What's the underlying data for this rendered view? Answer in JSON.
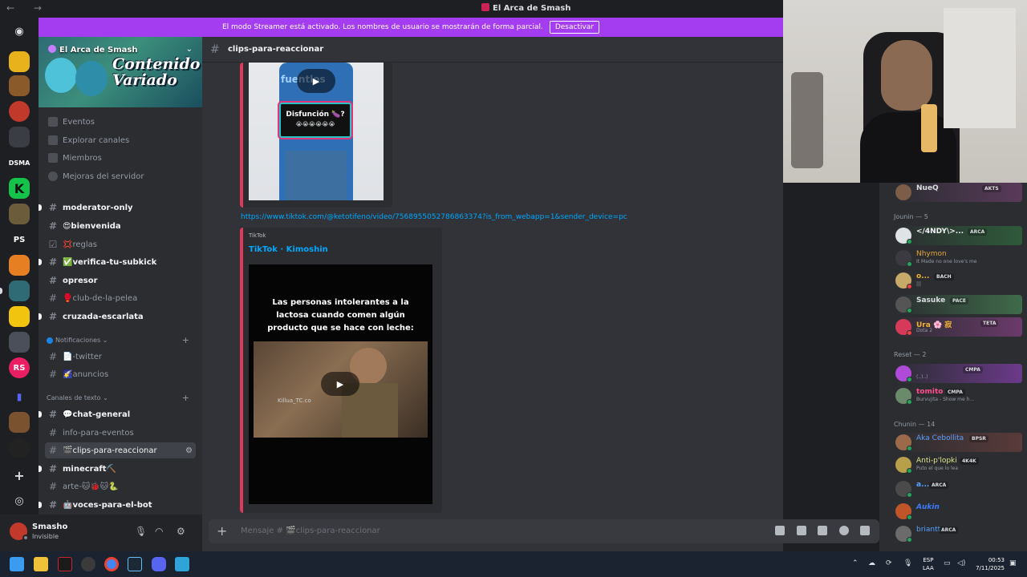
{
  "window": {
    "title": "El Arca de Smash",
    "nav": "← →"
  },
  "streamer_banner": {
    "text": "El modo Streamer está activado. Los nombres de usuario se mostrarán de forma parcial.",
    "button": "Desactivar"
  },
  "server": {
    "name": "El Arca de Smash",
    "banner_text_1": "Contenido",
    "banner_text_2": "Variado"
  },
  "rail": {
    "ps_label": "PS",
    "dsm_label": "DSMA"
  },
  "sidebar_meta": {
    "events": "Eventos",
    "explore": "Explorar canales",
    "members": "Miembros",
    "boost": "Mejoras del servidor"
  },
  "channels": {
    "c1": "moderator-only",
    "c2": "😍bienvenida",
    "c3": "💢reglas",
    "c4": "✅verifica-tu-subkick",
    "c5": "opresor",
    "c6": "🥊club-de-la-pelea",
    "c7": "cruzada-escarlata",
    "cat_notif": "Notificaciones",
    "c8": "📄-twitter",
    "c9": "🌠anuncios",
    "cat_text": "Canales de texto",
    "c10": "💬chat-general",
    "c11": "info-para-eventos",
    "c12": "🎬clips-para-reaccionar",
    "c13": "minecraft⛏️",
    "c14": "arte-🐱🐞🐱🐍",
    "c15": "🤖voces-para-el-bot"
  },
  "user": {
    "name": "Smasho",
    "status": "Invisible"
  },
  "chat": {
    "channel": "clips-para-reaccionar",
    "video1_text_top": "fuentlos",
    "video1_caption": "Disfunción 🍆?",
    "video1_emojis": "😭😭😭😭😭😭",
    "link": "https://www.tiktok.com/@ketotifeno/video/7568955052786863374?is_from_webapp=1&sender_device=pc",
    "embed_provider": "TikTok",
    "embed_title": "TikTok · Kimoshin",
    "video2_caption": "Las personas intolerantes a la lactosa cuando comen algún producto que se hace con leche:",
    "video2_watermark": "Killua_TC.co",
    "composer_placeholder": "Mensaje # 🎬clips-para-reaccionar"
  },
  "members": {
    "top_member": {
      "name": "NueQ",
      "tag": "AKTS"
    },
    "group1": "Jounin — 5",
    "m1": {
      "name": "</4NDY\\>...",
      "tag": "ARCA"
    },
    "m2": {
      "name": "Nhymon",
      "activity": "It Made no one love's me"
    },
    "m3": {
      "name": "o...",
      "tag": "BACH",
      "activity": "|||"
    },
    "m4": {
      "name": "Sasuke",
      "tag": "PACE"
    },
    "m5": {
      "name": "Ura 🌸 寂",
      "tag": "TETA",
      "activity": "Dota 2"
    },
    "group2": "Reset — 2",
    "m6": {
      "name": "",
      "tag": "CMPA",
      "activity": "(..)..)"
    },
    "m7": {
      "name": "tomito",
      "tag": "CMPA",
      "activity": "Burvujita - Show me h..."
    },
    "group3": "Chunin — 14",
    "m8": {
      "name": "Aka Cebollita",
      "tag": "BPSR"
    },
    "m9": {
      "name": "Anti-p'lopki",
      "tag": "4K4K",
      "activity": "Puto el que lo lea"
    },
    "m10": {
      "name": "a...",
      "tag": "ARCA"
    },
    "m11": {
      "name": "Aukin"
    },
    "m12": {
      "name": "briantt",
      "tag": "ARCA"
    }
  },
  "taskbar": {
    "lang1": "ESP",
    "lang2": "LAA",
    "time": "00:53",
    "date": "7/11/2025"
  },
  "colors": {
    "accent": "#a43cf0",
    "embed_bar": "#e03a5b",
    "link": "#00a8fc",
    "online": "#23a55a"
  }
}
